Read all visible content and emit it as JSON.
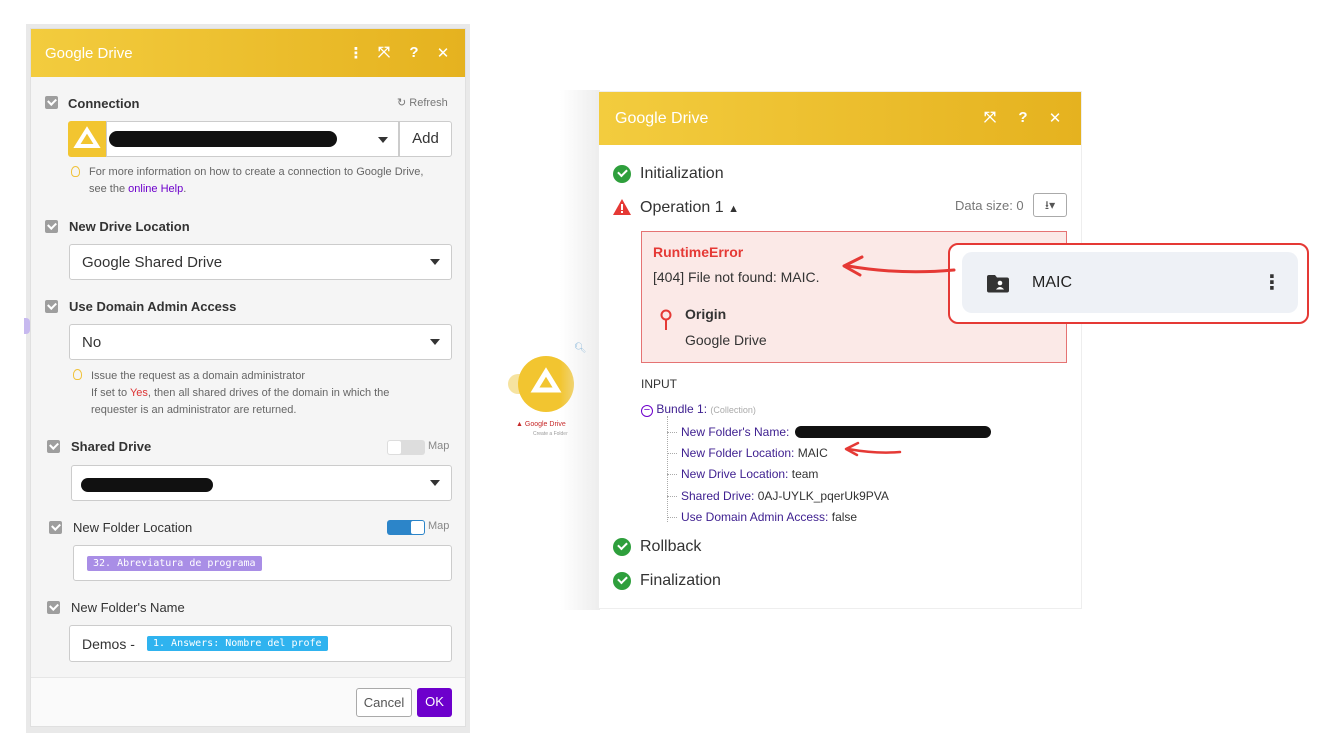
{
  "left_panel": {
    "title": "Google Drive",
    "connection": {
      "label": "Connection",
      "refresh_label": "Refresh",
      "add_label": "Add",
      "hint_text": "For more information on how to create a connection to Google Drive,",
      "hint_text2": "see the",
      "hint_link": "online Help",
      "hint_end": "."
    },
    "new_drive_location": {
      "label": "New Drive Location",
      "value": "Google Shared Drive"
    },
    "use_domain_admin": {
      "label": "Use Domain Admin Access",
      "value": "No",
      "hint1": "Issue the request as a domain administrator",
      "hint2_pre": "If set to",
      "hint2_yes": "Yes",
      "hint2_post": ", then all shared drives of the domain in which the",
      "hint3": "requester is an administrator are returned."
    },
    "shared_drive": {
      "label": "Shared Drive",
      "map_label": "Map"
    },
    "new_folder_location": {
      "label": "New Folder Location",
      "map_label": "Map",
      "pill": "32. Abreviatura de programa"
    },
    "new_folder_name": {
      "label": "New Folder's Name",
      "prefix": "Demos -",
      "pill": "1. Answers: Nombre del profe"
    },
    "cancel_label": "Cancel",
    "ok_label": "OK"
  },
  "node": {
    "label": "Google Drive",
    "sublabel": "Create a Folder"
  },
  "right_panel": {
    "title": "Google Drive",
    "initialization": "Initialization",
    "operation": "Operation 1",
    "data_size": "Data size: 0",
    "error": {
      "type": "RuntimeError",
      "message": "[404] File not found: MAIC.",
      "origin_label": "Origin",
      "origin_value": "Google Drive"
    },
    "input_label": "INPUT",
    "bundle_label": "Bundle 1:",
    "bundle_type": "(Collection)",
    "fields": [
      {
        "key": "New Folder's Name:",
        "value": ""
      },
      {
        "key": "New Folder Location:",
        "value": "MAIC"
      },
      {
        "key": "New Drive Location:",
        "value": "team"
      },
      {
        "key": "Shared Drive:",
        "value": "0AJ-UYLK_pqerUk9PVA"
      },
      {
        "key": "Use Domain Admin Access:",
        "value": "false"
      }
    ],
    "rollback": "Rollback",
    "finalization": "Finalization"
  },
  "callout": {
    "folder_name": "MAIC"
  },
  "colors": {
    "header": "#f0c233",
    "accent_purple": "#6d00cc",
    "error_red": "#e53935",
    "success_green": "#2e9f3c",
    "pill_purple": "#a98ee6",
    "pill_blue": "#2fb3ef"
  }
}
